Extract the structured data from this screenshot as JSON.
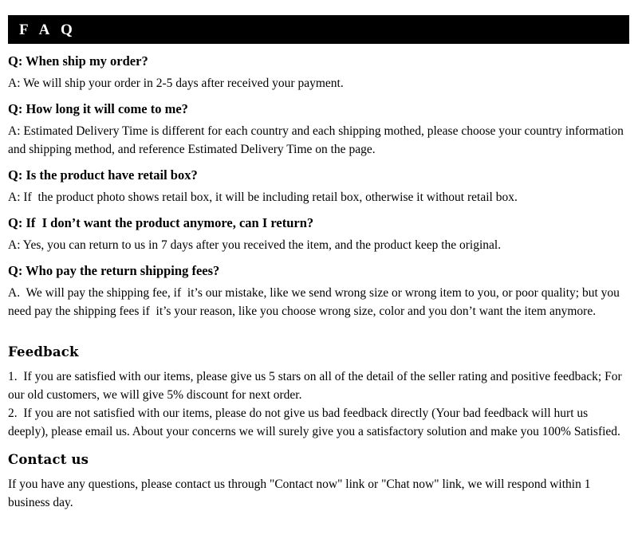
{
  "banner": {
    "title": "F A Q",
    "background_color": "#000000",
    "text_color": "#ffffff"
  },
  "faq": {
    "items": [
      {
        "question": "Q: When ship my order?",
        "answer": "A: We will ship your order in 2-5 days after received your payment."
      },
      {
        "question": "Q: How long it will come to me?",
        "answer": "A: Estimated Delivery Time is different for each country and each shipping mothed, please choose your country information and shipping method, and reference Estimated Delivery Time on the page."
      },
      {
        "question": "Q: Is the product have retail box?",
        "answer": "A: If  the product photo shows retail box, it will be including retail box, otherwise it without retail box."
      },
      {
        "question": "Q: If  I don’t want the product anymore, can I return?",
        "answer": "A: Yes, you can return to us in 7 days after you received the item, and the product keep the original."
      },
      {
        "question": "Q: Who pay the return shipping fees?",
        "answer": "A.  We will pay the shipping fee, if  it’s our mistake, like we send wrong size or wrong item to you, or poor quality; but you need pay the shipping fees if  it’s your reason, like you choose wrong size, color and you don’t want the item anymore."
      }
    ]
  },
  "feedback": {
    "heading": "Feedback",
    "item_1": "1.  If you are satisfied with our items, please give us 5 stars on all of the detail of the seller rating and positive feedback; For our old customers, we will give 5% discount for next order.",
    "item_2": "2.  If you are not satisfied with our items, please do not give us bad feedback directly (Your bad feedback will hurt us deeply), please email us. About your concerns we will surely give you a satisfactory solution and make you 100% Satisfied."
  },
  "contact": {
    "heading": "Contact us",
    "body": "If you have any questions, please contact us through \"Contact now\" link or \"Chat now\" link, we will respond within 1 business day."
  }
}
